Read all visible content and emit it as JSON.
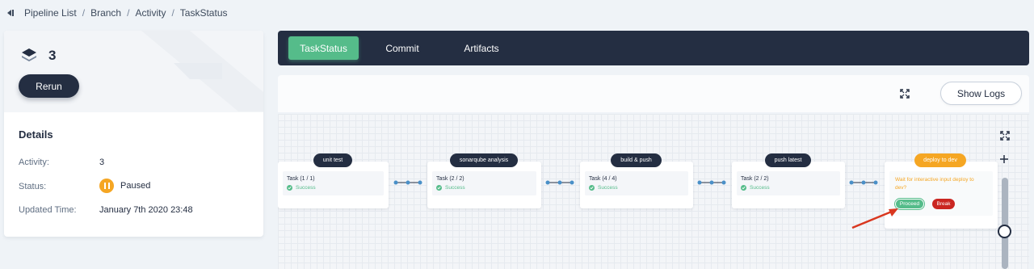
{
  "breadcrumb": {
    "items": [
      "Pipeline List",
      "Branch",
      "Activity",
      "TaskStatus"
    ],
    "separator": "/"
  },
  "activity": {
    "number": "3",
    "rerun_label": "Rerun"
  },
  "details": {
    "title": "Details",
    "rows": [
      {
        "label": "Activity:",
        "value": "3"
      },
      {
        "label": "Status:",
        "value": "Paused",
        "status_color": "#f5a623"
      },
      {
        "label": "Updated Time:",
        "value": "January 7th 2020 23:48"
      }
    ]
  },
  "tabs": [
    {
      "label": "TaskStatus",
      "active": true
    },
    {
      "label": "Commit",
      "active": false
    },
    {
      "label": "Artifacts",
      "active": false
    }
  ],
  "toolbar": {
    "show_logs_label": "Show Logs"
  },
  "pipeline": {
    "stages": [
      {
        "name": "unit test",
        "task": "Task (1 / 1)",
        "status": "Success"
      },
      {
        "name": "sonarqube analysis",
        "task": "Task (2 / 2)",
        "status": "Success"
      },
      {
        "name": "build & push",
        "task": "Task (4 / 4)",
        "status": "Success"
      },
      {
        "name": "push latest",
        "task": "Task (2 / 2)",
        "status": "Success"
      },
      {
        "name": "deploy to dev",
        "wait_message": "Wait for interactive input deploy to dev?",
        "proceed_label": "Proceed",
        "break_label": "Break"
      }
    ]
  },
  "colors": {
    "dark": "#242e42",
    "success": "#55bc8a",
    "warning": "#f5a623",
    "danger": "#ca2621",
    "annotation_arrow": "#d9371f"
  },
  "icons": {
    "back": "back-arrow-icon",
    "activity": "layers-icon",
    "status": "pause-icon",
    "fullscreen": "expand-icon",
    "zoom_in": "plus-icon",
    "task_status": "check-circle-icon"
  }
}
